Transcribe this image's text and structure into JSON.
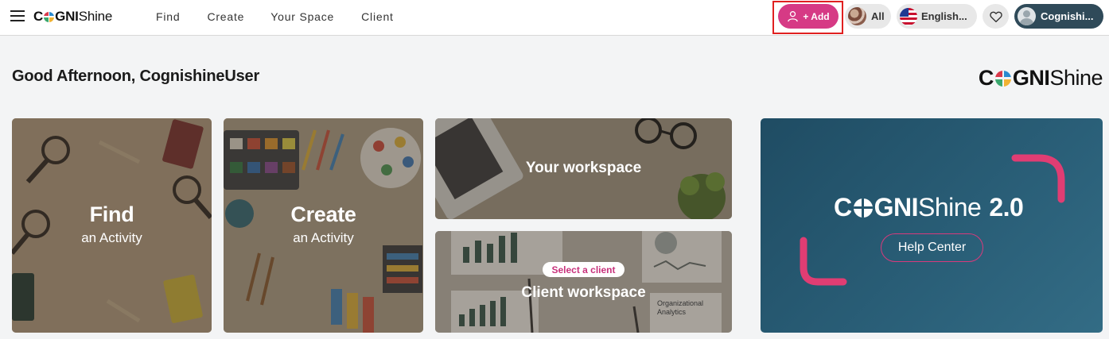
{
  "header": {
    "logo_bold": "COGNI",
    "logo_thin": "Shine",
    "nav": [
      "Find",
      "Create",
      "Your Space",
      "Client"
    ],
    "add_label": "+ Add",
    "filter_label": "All",
    "language_label": "English...",
    "user_label": "Cognishi..."
  },
  "main": {
    "greeting": "Good Afternoon, CognishineUser",
    "brand_bold": "COGNI",
    "brand_thin": "Shine"
  },
  "cards": {
    "find": {
      "title": "Find",
      "subtitle": "an Activity"
    },
    "create": {
      "title": "Create",
      "subtitle": "an Activity"
    },
    "workspace": {
      "title": "Your workspace"
    },
    "client": {
      "badge": "Select a client",
      "title": "Client workspace",
      "photo_caption": "Organizational Analytics"
    }
  },
  "help": {
    "logo_bold": "COGNI",
    "logo_thin": "Shine",
    "version": "2.0",
    "button_label": "Help Center"
  },
  "colors": {
    "accent_pink": "#d63a85",
    "brand_teal": "#2f4a59",
    "logo_red": "#d9394b",
    "logo_blue": "#2a8bd0",
    "logo_yellow": "#f1b233",
    "logo_green": "#3aa76d"
  }
}
